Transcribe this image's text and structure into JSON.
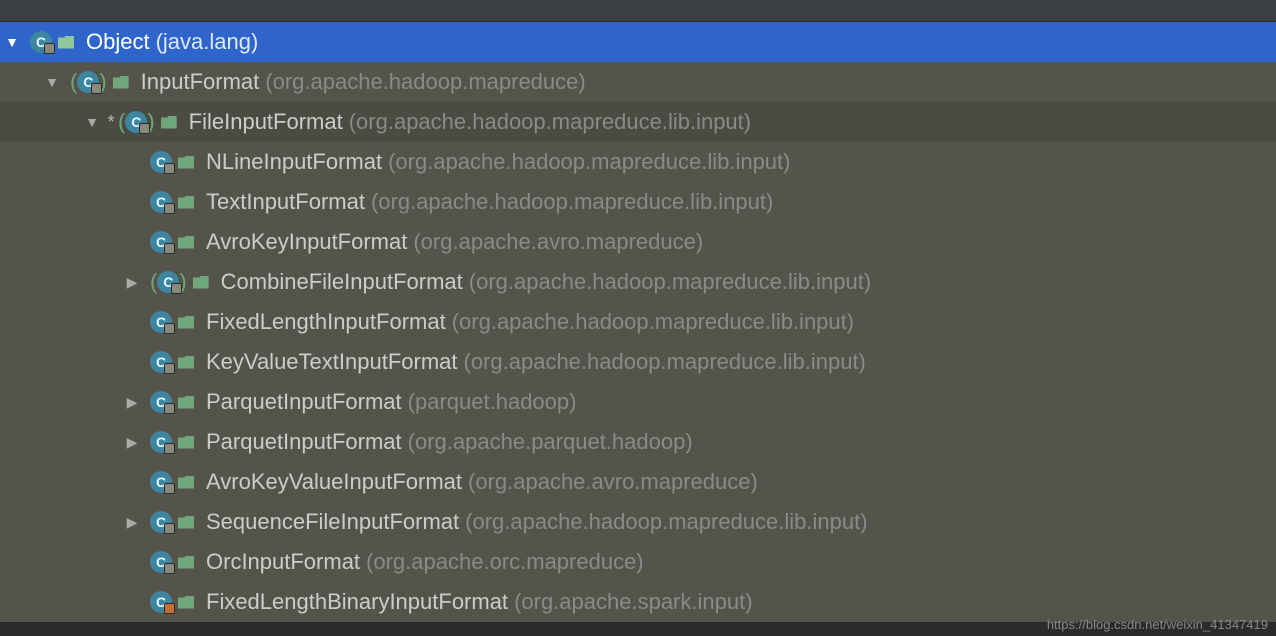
{
  "watermark": "https://blog.csdn.net/weixin_41347419",
  "tree": [
    {
      "depth": 0,
      "arrow": "down",
      "abstract": false,
      "star": false,
      "lock": "grey",
      "name": "Object",
      "pkg": "(java.lang)",
      "selected": true
    },
    {
      "depth": 1,
      "arrow": "down",
      "abstract": true,
      "star": false,
      "lock": "grey",
      "name": "InputFormat",
      "pkg": "(org.apache.hadoop.mapreduce)",
      "selected": false
    },
    {
      "depth": 2,
      "arrow": "down",
      "abstract": true,
      "star": true,
      "lock": "grey",
      "name": "FileInputFormat",
      "pkg": "(org.apache.hadoop.mapreduce.lib.input)",
      "selected": false,
      "current": true
    },
    {
      "depth": 3,
      "arrow": "",
      "abstract": false,
      "star": false,
      "lock": "grey",
      "name": "NLineInputFormat",
      "pkg": "(org.apache.hadoop.mapreduce.lib.input)",
      "selected": false
    },
    {
      "depth": 3,
      "arrow": "",
      "abstract": false,
      "star": false,
      "lock": "grey",
      "name": "TextInputFormat",
      "pkg": "(org.apache.hadoop.mapreduce.lib.input)",
      "selected": false
    },
    {
      "depth": 3,
      "arrow": "",
      "abstract": false,
      "star": false,
      "lock": "grey",
      "name": "AvroKeyInputFormat",
      "pkg": "(org.apache.avro.mapreduce)",
      "selected": false
    },
    {
      "depth": 3,
      "arrow": "right",
      "abstract": true,
      "star": false,
      "lock": "grey",
      "name": "CombineFileInputFormat",
      "pkg": "(org.apache.hadoop.mapreduce.lib.input)",
      "selected": false
    },
    {
      "depth": 3,
      "arrow": "",
      "abstract": false,
      "star": false,
      "lock": "grey",
      "name": "FixedLengthInputFormat",
      "pkg": "(org.apache.hadoop.mapreduce.lib.input)",
      "selected": false
    },
    {
      "depth": 3,
      "arrow": "",
      "abstract": false,
      "star": false,
      "lock": "grey",
      "name": "KeyValueTextInputFormat",
      "pkg": "(org.apache.hadoop.mapreduce.lib.input)",
      "selected": false
    },
    {
      "depth": 3,
      "arrow": "right",
      "abstract": false,
      "star": false,
      "lock": "grey",
      "name": "ParquetInputFormat",
      "pkg": "(parquet.hadoop)",
      "selected": false
    },
    {
      "depth": 3,
      "arrow": "right",
      "abstract": false,
      "star": false,
      "lock": "grey",
      "name": "ParquetInputFormat",
      "pkg": "(org.apache.parquet.hadoop)",
      "selected": false
    },
    {
      "depth": 3,
      "arrow": "",
      "abstract": false,
      "star": false,
      "lock": "grey",
      "name": "AvroKeyValueInputFormat",
      "pkg": "(org.apache.avro.mapreduce)",
      "selected": false
    },
    {
      "depth": 3,
      "arrow": "right",
      "abstract": false,
      "star": false,
      "lock": "grey",
      "name": "SequenceFileInputFormat",
      "pkg": "(org.apache.hadoop.mapreduce.lib.input)",
      "selected": false
    },
    {
      "depth": 3,
      "arrow": "",
      "abstract": false,
      "star": false,
      "lock": "grey",
      "name": "OrcInputFormat",
      "pkg": "(org.apache.orc.mapreduce)",
      "selected": false
    },
    {
      "depth": 3,
      "arrow": "",
      "abstract": false,
      "star": false,
      "lock": "red",
      "name": "FixedLengthBinaryInputFormat",
      "pkg": "(org.apache.spark.input)",
      "selected": false
    }
  ]
}
